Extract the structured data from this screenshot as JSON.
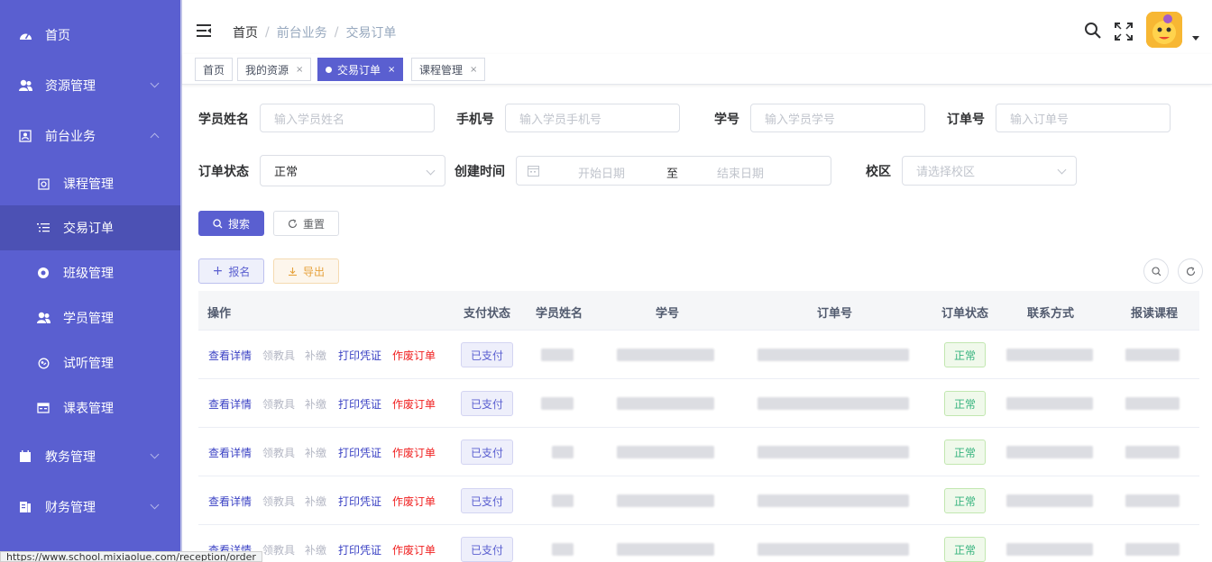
{
  "sidebar": {
    "items": [
      {
        "label": "首页",
        "icon": "dashboard-icon"
      },
      {
        "label": "资源管理",
        "icon": "users-icon"
      },
      {
        "label": "前台业务",
        "icon": "reception-icon"
      },
      {
        "label": "课程管理",
        "icon": "course-icon"
      },
      {
        "label": "交易订单",
        "icon": "list-icon"
      },
      {
        "label": "班级管理",
        "icon": "lifebuoy-icon"
      },
      {
        "label": "学员管理",
        "icon": "student-icon"
      },
      {
        "label": "试听管理",
        "icon": "audition-icon"
      },
      {
        "label": "课表管理",
        "icon": "timetable-icon"
      },
      {
        "label": "教务管理",
        "icon": "calendar-icon"
      },
      {
        "label": "财务管理",
        "icon": "finance-icon"
      }
    ]
  },
  "header": {
    "breadcrumb": [
      "首页",
      "前台业务",
      "交易订单"
    ],
    "separator": "/"
  },
  "tags": [
    {
      "label": "首页"
    },
    {
      "label": "我的资源",
      "close": "×"
    },
    {
      "label": "交易订单",
      "close": "×"
    },
    {
      "label": "课程管理",
      "close": "×"
    }
  ],
  "filters": {
    "student_name": {
      "label": "学员姓名",
      "placeholder": "输入学员姓名"
    },
    "phone": {
      "label": "手机号",
      "placeholder": "输入学员手机号"
    },
    "student_no": {
      "label": "学号",
      "placeholder": "输入学员学号"
    },
    "order_no": {
      "label": "订单号",
      "placeholder": "输入订单号"
    },
    "order_status": {
      "label": "订单状态",
      "value": "正常"
    },
    "created_time": {
      "label": "创建时间",
      "start": "开始日期",
      "to": "至",
      "end": "结束日期"
    },
    "campus": {
      "label": "校区",
      "placeholder": "请选择校区"
    }
  },
  "buttons": {
    "search": "搜索",
    "reset": "重置",
    "enroll": "报名",
    "export": "导出"
  },
  "table": {
    "columns": [
      "操作",
      "支付状态",
      "学员姓名",
      "学号",
      "订单号",
      "订单状态",
      "联系方式",
      "报读课程"
    ],
    "actions": [
      "查看详情",
      "领教具",
      "补缴",
      "打印凭证",
      "作废订单"
    ],
    "rows": [
      {
        "pay_status": "已支付",
        "order_status": "正常"
      },
      {
        "pay_status": "已支付",
        "order_status": "正常"
      },
      {
        "pay_status": "已支付",
        "order_status": "正常"
      },
      {
        "pay_status": "已支付",
        "order_status": "正常"
      },
      {
        "pay_status": "已支付",
        "order_status": "正常"
      }
    ]
  },
  "status_url": "https://www.school.mixiaolue.com/reception/order",
  "colors": {
    "primary": "#5a5fd0",
    "danger": "#f02020",
    "success": "#36b37e",
    "warning": "#e6a23c"
  }
}
